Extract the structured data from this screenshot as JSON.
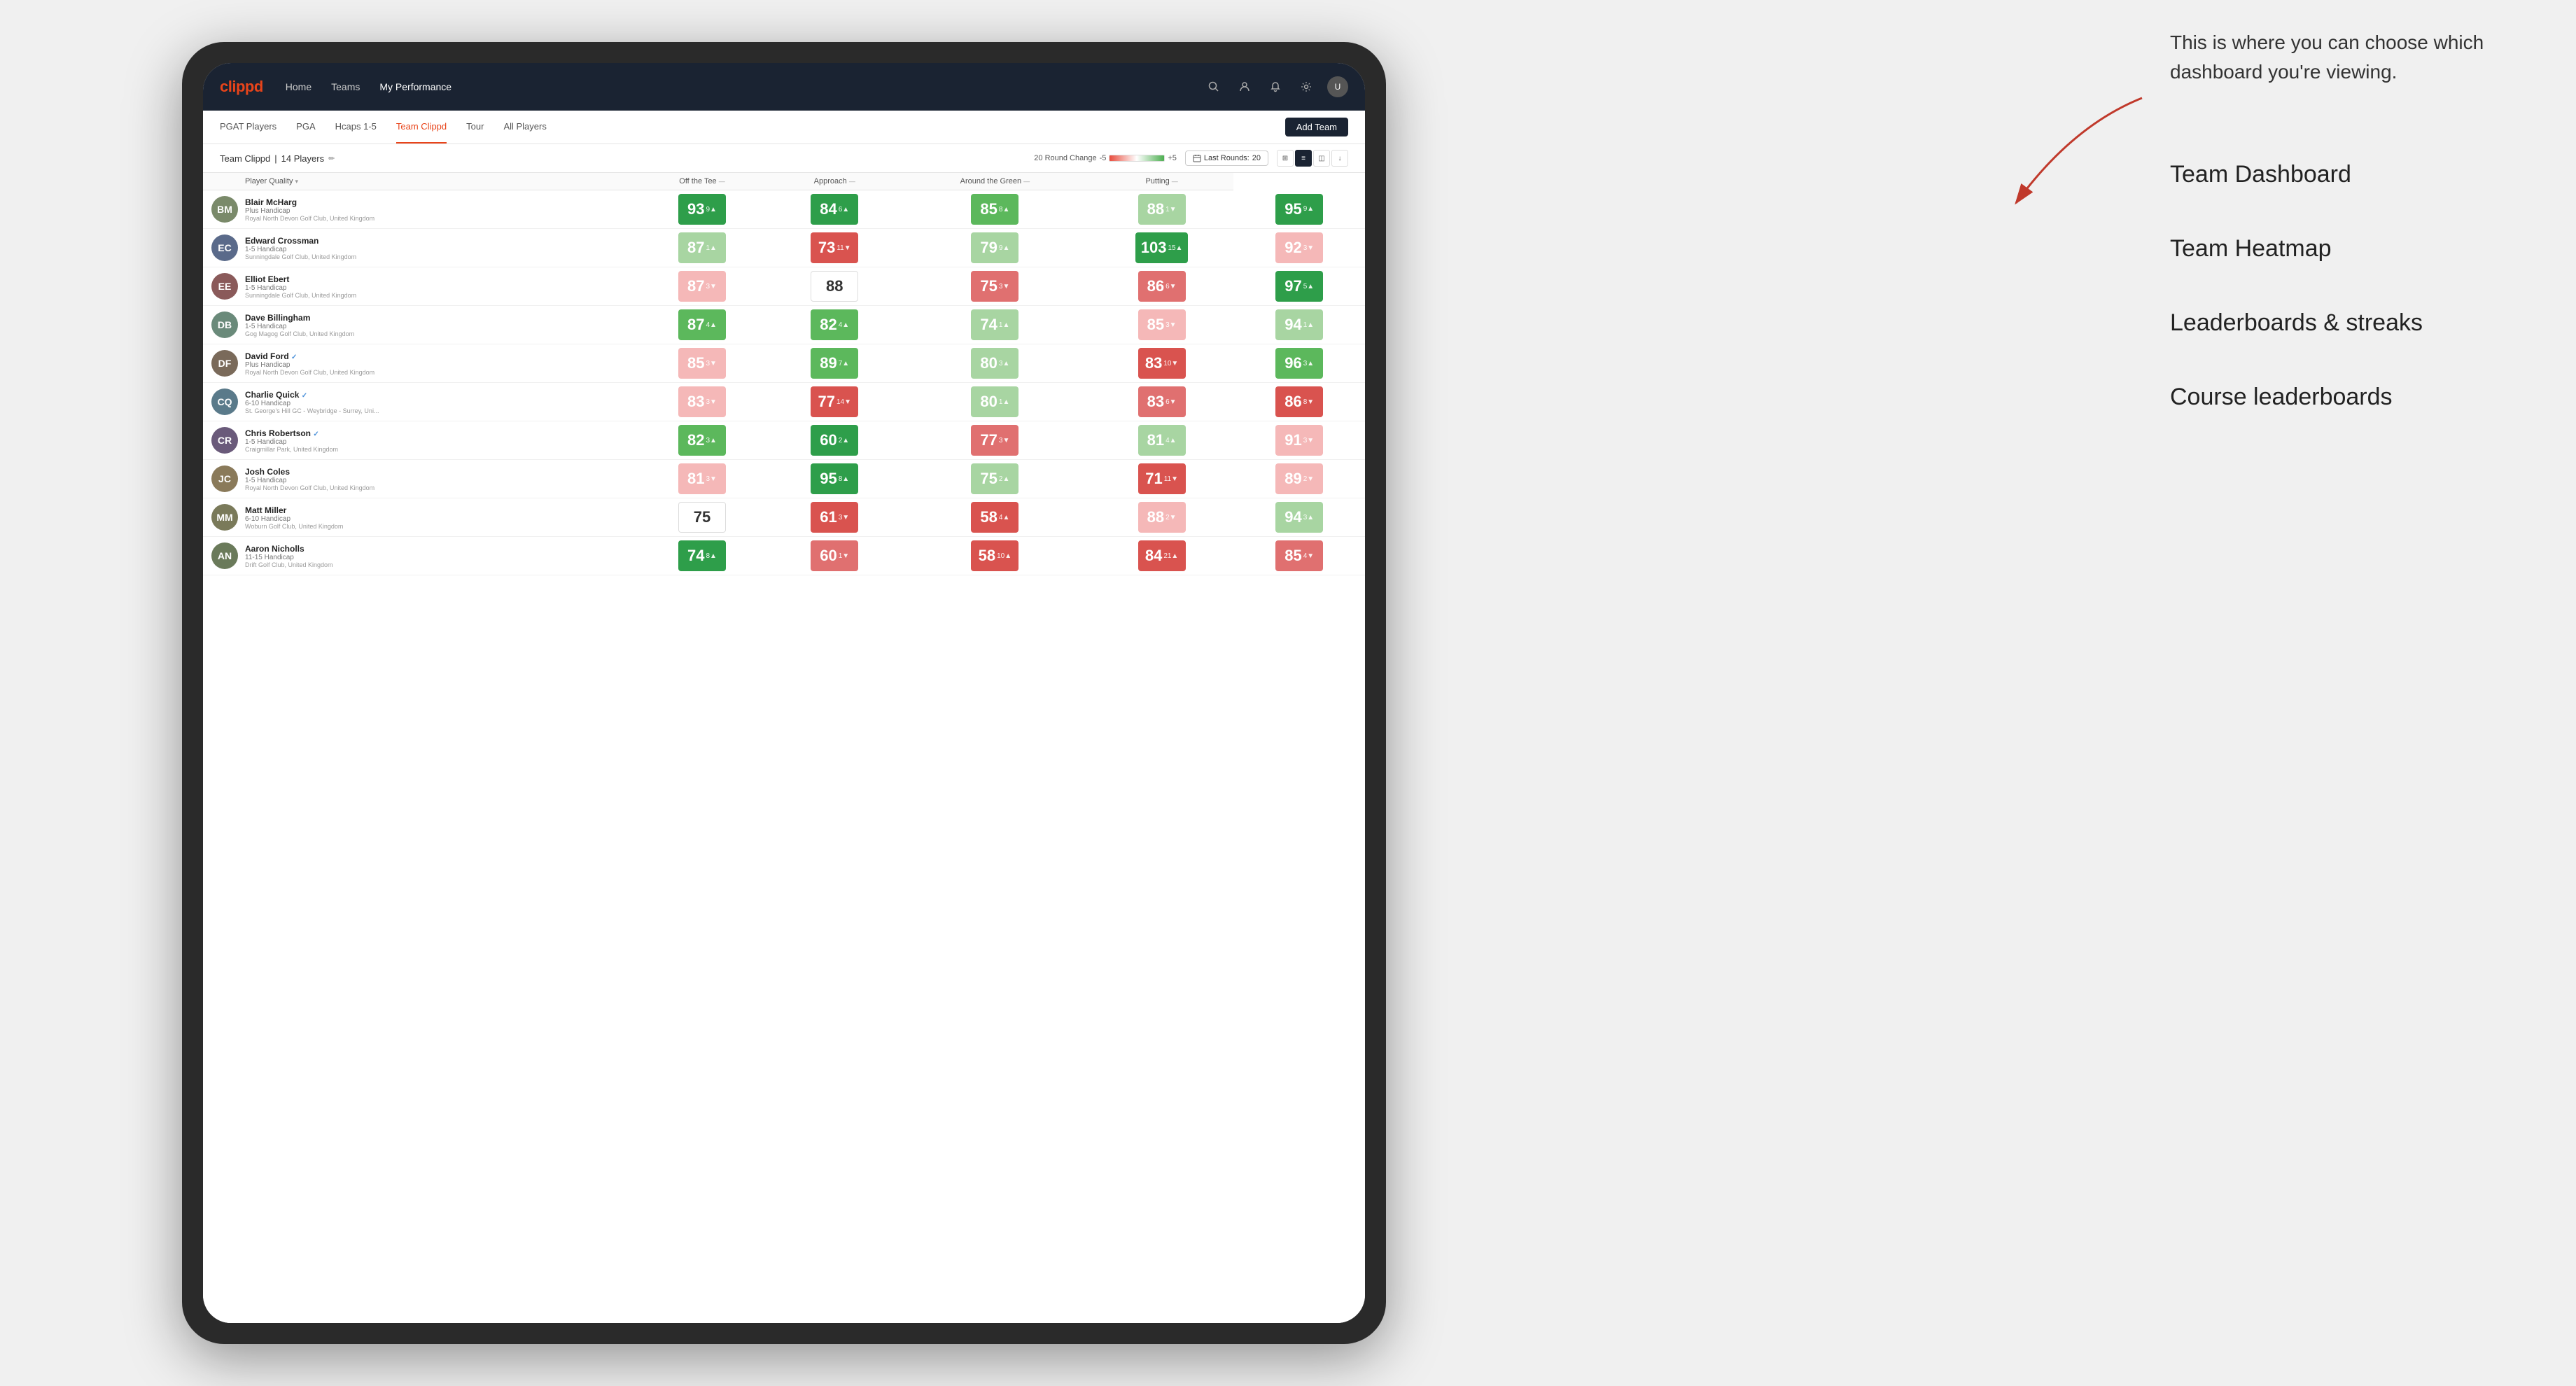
{
  "annotation": {
    "intro_text": "This is where you can choose which dashboard you're viewing.",
    "items": [
      "Team Dashboard",
      "Team Heatmap",
      "Leaderboards & streaks",
      "Course leaderboards"
    ]
  },
  "navbar": {
    "logo": "clippd",
    "links": [
      {
        "label": "Home",
        "active": false
      },
      {
        "label": "Teams",
        "active": false
      },
      {
        "label": "My Performance",
        "active": true
      }
    ],
    "icons": [
      "search",
      "user",
      "bell",
      "settings",
      "avatar"
    ]
  },
  "subnav": {
    "links": [
      {
        "label": "PGAT Players",
        "active": false
      },
      {
        "label": "PGA",
        "active": false
      },
      {
        "label": "Hcaps 1-5",
        "active": false
      },
      {
        "label": "Team Clippd",
        "active": true
      },
      {
        "label": "Tour",
        "active": false
      },
      {
        "label": "All Players",
        "active": false
      }
    ],
    "add_team_label": "Add Team"
  },
  "team_header": {
    "title": "Team Clippd",
    "separator": "|",
    "count": "14 Players",
    "round_change_label": "20 Round Change",
    "range_min": "-5",
    "range_max": "+5",
    "last_rounds_label": "Last Rounds:",
    "last_rounds_value": "20"
  },
  "table": {
    "columns": [
      {
        "label": "Player Quality",
        "sort": true
      },
      {
        "label": "Off the Tee",
        "sort": true
      },
      {
        "label": "Approach",
        "sort": true
      },
      {
        "label": "Around the Green",
        "sort": true
      },
      {
        "label": "Putting",
        "sort": true
      }
    ],
    "players": [
      {
        "name": "Blair McHarg",
        "handicap": "Plus Handicap",
        "club": "Royal North Devon Golf Club, United Kingdom",
        "avatar_color": "#7a8a6a",
        "avatar_initials": "BM",
        "scores": [
          {
            "value": "93",
            "change": "9",
            "dir": "up",
            "color": "green-dark"
          },
          {
            "value": "84",
            "change": "6",
            "dir": "up",
            "color": "green-dark"
          },
          {
            "value": "85",
            "change": "8",
            "dir": "up",
            "color": "green-mid"
          },
          {
            "value": "88",
            "change": "1",
            "dir": "down",
            "color": "green-light"
          },
          {
            "value": "95",
            "change": "9",
            "dir": "up",
            "color": "green-dark"
          }
        ]
      },
      {
        "name": "Edward Crossman",
        "handicap": "1-5 Handicap",
        "club": "Sunningdale Golf Club, United Kingdom",
        "avatar_color": "#5a6a8a",
        "avatar_initials": "EC",
        "scores": [
          {
            "value": "87",
            "change": "1",
            "dir": "up",
            "color": "green-light"
          },
          {
            "value": "73",
            "change": "11",
            "dir": "down",
            "color": "red-dark"
          },
          {
            "value": "79",
            "change": "9",
            "dir": "up",
            "color": "green-light"
          },
          {
            "value": "103",
            "change": "15",
            "dir": "up",
            "color": "green-dark"
          },
          {
            "value": "92",
            "change": "3",
            "dir": "down",
            "color": "red-light"
          }
        ]
      },
      {
        "name": "Elliot Ebert",
        "handicap": "1-5 Handicap",
        "club": "Sunningdale Golf Club, United Kingdom",
        "avatar_color": "#8a5a5a",
        "avatar_initials": "EE",
        "scores": [
          {
            "value": "87",
            "change": "3",
            "dir": "down",
            "color": "red-light"
          },
          {
            "value": "88",
            "change": "",
            "dir": "neutral",
            "color": "white"
          },
          {
            "value": "75",
            "change": "3",
            "dir": "down",
            "color": "red-mid"
          },
          {
            "value": "86",
            "change": "6",
            "dir": "down",
            "color": "red-mid"
          },
          {
            "value": "97",
            "change": "5",
            "dir": "up",
            "color": "green-dark"
          }
        ]
      },
      {
        "name": "Dave Billingham",
        "handicap": "1-5 Handicap",
        "club": "Gog Magog Golf Club, United Kingdom",
        "avatar_color": "#6a8a7a",
        "avatar_initials": "DB",
        "scores": [
          {
            "value": "87",
            "change": "4",
            "dir": "up",
            "color": "green-mid"
          },
          {
            "value": "82",
            "change": "4",
            "dir": "up",
            "color": "green-mid"
          },
          {
            "value": "74",
            "change": "1",
            "dir": "up",
            "color": "green-light"
          },
          {
            "value": "85",
            "change": "3",
            "dir": "down",
            "color": "red-light"
          },
          {
            "value": "94",
            "change": "1",
            "dir": "up",
            "color": "green-light"
          }
        ]
      },
      {
        "name": "David Ford",
        "handicap": "Plus Handicap",
        "club": "Royal North Devon Golf Club, United Kingdom",
        "avatar_color": "#7a6a5a",
        "avatar_initials": "DF",
        "verified": true,
        "scores": [
          {
            "value": "85",
            "change": "3",
            "dir": "down",
            "color": "red-light"
          },
          {
            "value": "89",
            "change": "7",
            "dir": "up",
            "color": "green-mid"
          },
          {
            "value": "80",
            "change": "3",
            "dir": "up",
            "color": "green-light"
          },
          {
            "value": "83",
            "change": "10",
            "dir": "down",
            "color": "red-dark"
          },
          {
            "value": "96",
            "change": "3",
            "dir": "up",
            "color": "green-mid"
          }
        ]
      },
      {
        "name": "Charlie Quick",
        "handicap": "6-10 Handicap",
        "club": "St. George's Hill GC - Weybridge - Surrey, Uni...",
        "avatar_color": "#5a7a8a",
        "avatar_initials": "CQ",
        "verified": true,
        "scores": [
          {
            "value": "83",
            "change": "3",
            "dir": "down",
            "color": "red-light"
          },
          {
            "value": "77",
            "change": "14",
            "dir": "down",
            "color": "red-dark"
          },
          {
            "value": "80",
            "change": "1",
            "dir": "up",
            "color": "green-light"
          },
          {
            "value": "83",
            "change": "6",
            "dir": "down",
            "color": "red-mid"
          },
          {
            "value": "86",
            "change": "8",
            "dir": "down",
            "color": "red-dark"
          }
        ]
      },
      {
        "name": "Chris Robertson",
        "handicap": "1-5 Handicap",
        "club": "Craigmillar Park, United Kingdom",
        "avatar_color": "#6a5a7a",
        "avatar_initials": "CR",
        "verified": true,
        "scores": [
          {
            "value": "82",
            "change": "3",
            "dir": "up",
            "color": "green-mid"
          },
          {
            "value": "60",
            "change": "2",
            "dir": "up",
            "color": "green-dark"
          },
          {
            "value": "77",
            "change": "3",
            "dir": "down",
            "color": "red-mid"
          },
          {
            "value": "81",
            "change": "4",
            "dir": "up",
            "color": "green-light"
          },
          {
            "value": "91",
            "change": "3",
            "dir": "down",
            "color": "red-light"
          }
        ]
      },
      {
        "name": "Josh Coles",
        "handicap": "1-5 Handicap",
        "club": "Royal North Devon Golf Club, United Kingdom",
        "avatar_color": "#8a7a5a",
        "avatar_initials": "JC",
        "scores": [
          {
            "value": "81",
            "change": "3",
            "dir": "down",
            "color": "red-light"
          },
          {
            "value": "95",
            "change": "8",
            "dir": "up",
            "color": "green-dark"
          },
          {
            "value": "75",
            "change": "2",
            "dir": "up",
            "color": "green-light"
          },
          {
            "value": "71",
            "change": "11",
            "dir": "down",
            "color": "red-dark"
          },
          {
            "value": "89",
            "change": "2",
            "dir": "down",
            "color": "red-light"
          }
        ]
      },
      {
        "name": "Matt Miller",
        "handicap": "6-10 Handicap",
        "club": "Woburn Golf Club, United Kingdom",
        "avatar_color": "#7a7a5a",
        "avatar_initials": "MM",
        "scores": [
          {
            "value": "75",
            "change": "",
            "dir": "neutral",
            "color": "white"
          },
          {
            "value": "61",
            "change": "3",
            "dir": "down",
            "color": "red-dark"
          },
          {
            "value": "58",
            "change": "4",
            "dir": "up",
            "color": "red-dark"
          },
          {
            "value": "88",
            "change": "2",
            "dir": "down",
            "color": "red-light"
          },
          {
            "value": "94",
            "change": "3",
            "dir": "up",
            "color": "green-light"
          }
        ]
      },
      {
        "name": "Aaron Nicholls",
        "handicap": "11-15 Handicap",
        "club": "Drift Golf Club, United Kingdom",
        "avatar_color": "#6a7a5a",
        "avatar_initials": "AN",
        "scores": [
          {
            "value": "74",
            "change": "8",
            "dir": "up",
            "color": "green-dark"
          },
          {
            "value": "60",
            "change": "1",
            "dir": "down",
            "color": "red-mid"
          },
          {
            "value": "58",
            "change": "10",
            "dir": "up",
            "color": "red-dark"
          },
          {
            "value": "84",
            "change": "21",
            "dir": "up",
            "color": "red-dark"
          },
          {
            "value": "85",
            "change": "4",
            "dir": "down",
            "color": "red-mid"
          }
        ]
      }
    ]
  }
}
